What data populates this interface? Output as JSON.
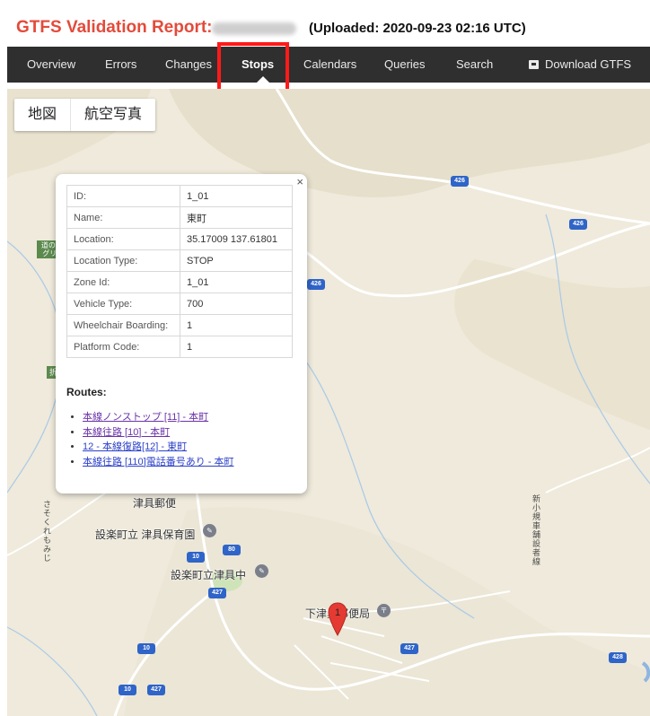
{
  "header": {
    "title": "GTFS Validation Report:",
    "uploaded": "(Uploaded: 2020-09-23 02:16 UTC)"
  },
  "nav": {
    "items": [
      "Overview",
      "Errors",
      "Changes",
      "Stops",
      "Calendars",
      "Queries",
      "Search",
      "Download GTFS"
    ],
    "active": "Stops"
  },
  "map_type": {
    "map": "地図",
    "satellite": "航空写真"
  },
  "map": {
    "poi_green": "道の駅 つぐ高原\nグリーンパーク",
    "side_tag": "折",
    "shields": [
      "426",
      "426",
      "426",
      "428",
      "80",
      "10",
      "427",
      "10",
      "10",
      "427",
      "427"
    ],
    "labels": {
      "nursery": "設楽町立 津具保育園",
      "junior_high": "設楽町立津具中",
      "post_office": "下津具郵便局",
      "post_office_top": "津具郵便",
      "vertical_road_1": "さそくれもみじ",
      "vertical_road_2": "新小規車舗設者線"
    },
    "marker_label": "1"
  },
  "popup": {
    "close": "×",
    "fields": [
      {
        "key": "ID:",
        "value": "1_01"
      },
      {
        "key": "Name:",
        "value": "東町"
      },
      {
        "key": "Location:",
        "value": "35.17009 137.61801"
      },
      {
        "key": "Location Type:",
        "value": "STOP"
      },
      {
        "key": "Zone Id:",
        "value": "1_01"
      },
      {
        "key": "Vehicle Type:",
        "value": "700"
      },
      {
        "key": "Wheelchair Boarding:",
        "value": "1"
      },
      {
        "key": "Platform Code:",
        "value": "1"
      }
    ],
    "routes_heading": "Routes:",
    "routes": [
      "本線ノンストップ [11] - 本町",
      "本線往路 [10] - 本町",
      "12 - 本線復路[12] - 東町",
      "本線往路 [110]電話番号あり - 本町"
    ]
  },
  "colors": {
    "accent": "#e44a3a",
    "nav_bg": "#2f2f2f",
    "highlight": "#ff1a1a",
    "map_bg": "#efeadb",
    "road_shield": "#2f64c8",
    "marker": "#e53a32"
  }
}
